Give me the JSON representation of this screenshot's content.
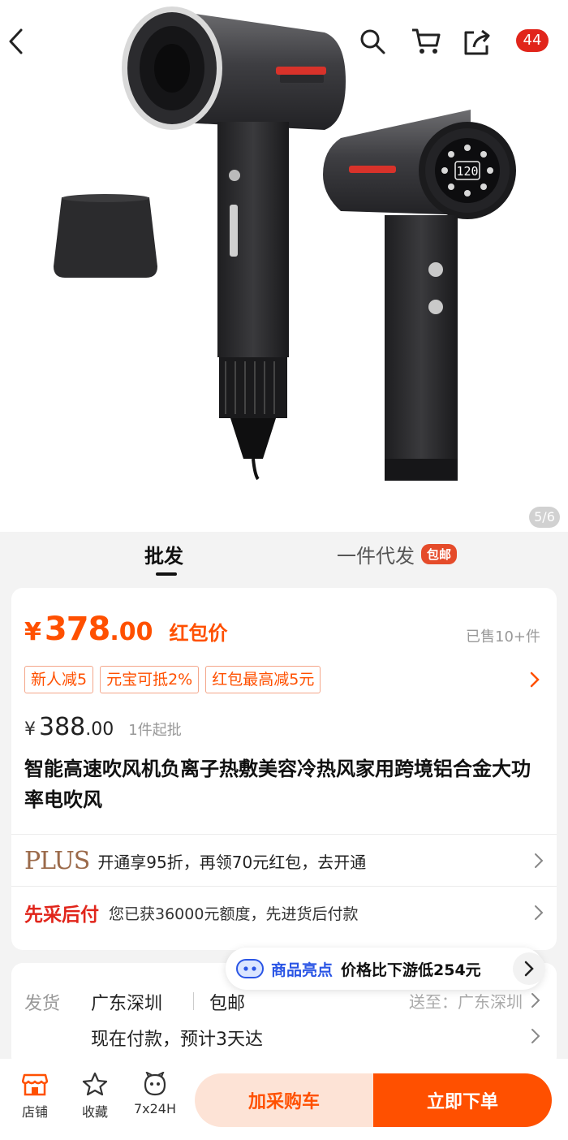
{
  "header": {
    "cart_badge": "44",
    "image_indicator": "5/6"
  },
  "tabs": [
    {
      "label": "批发"
    },
    {
      "label": "一件代发",
      "badge": "包邮"
    }
  ],
  "price": {
    "currency": "¥",
    "integer": "378",
    "decimal": ".00",
    "tag": "红包价",
    "sold": "已售10+件"
  },
  "coupons": [
    "新人减5",
    "元宝可抵2%",
    "红包最高减5元"
  ],
  "original_price": {
    "currency": "¥",
    "integer": "388",
    "decimal": ".00",
    "moq": "1件起批"
  },
  "product": {
    "title": "智能高速吹风机负离子热敷美容冷热风家用跨境铝合金大功率电吹风",
    "display_readout": "120"
  },
  "plus": {
    "logo": "PLUS",
    "text": "开通享95折，再领70元红包，去开通"
  },
  "bnpl": {
    "logo": "先采后付",
    "text": "您已获36000元额度，先进货后付款"
  },
  "highlight": {
    "label": "商品亮点",
    "text": "价格比下游低254元"
  },
  "shipping": {
    "label": "发货",
    "origin": "广东深圳",
    "free": "包邮",
    "destination": "送至：广东深圳",
    "eta": "现在付款，预计3天达"
  },
  "bottom_bar": {
    "store": "店铺",
    "favorite": "收藏",
    "service": "7x24H",
    "add_cart": "加采购车",
    "buy_now": "立即下单"
  },
  "colors": {
    "accent": "#ff5000",
    "plus_gold": "#9b6a4a",
    "bnpl_red": "#e1251b",
    "highlight_blue": "#2a55e5"
  }
}
